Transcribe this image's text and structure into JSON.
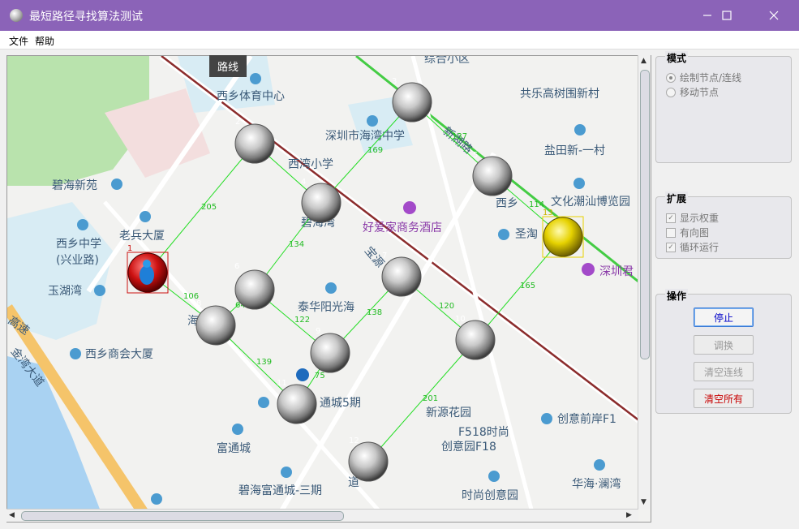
{
  "window": {
    "title": "最短路径寻找算法测试",
    "minimize": "—",
    "maximize": "☐",
    "close": "✕"
  },
  "menu": [
    "文件",
    "帮助"
  ],
  "tooltip": "路线",
  "map_labels": [
    {
      "text": "西乡体育中心"
    },
    {
      "text": "深圳市海湾中学"
    },
    {
      "text": "西湾小学"
    },
    {
      "text": "碧海新苑"
    },
    {
      "text": "老兵大厦"
    },
    {
      "text": "西乡中学"
    },
    {
      "text": "(兴业路)"
    },
    {
      "text": "玉湖湾"
    },
    {
      "text": "西乡商会大厦"
    },
    {
      "text": "泰华阳光海"
    },
    {
      "text": "好爱家商务酒店"
    },
    {
      "text": "碧海湾"
    },
    {
      "text": "共乐高树围新村"
    },
    {
      "text": "盐田新-一村"
    },
    {
      "text": "文化潮汕博览园"
    },
    {
      "text": "圣淘"
    },
    {
      "text": "深圳君"
    },
    {
      "text": "新源花园"
    },
    {
      "text": "F518时尚"
    },
    {
      "text": "创意园F18"
    },
    {
      "text": "创意前岸F1"
    },
    {
      "text": "富通城"
    },
    {
      "text": "碧海富通城-三期"
    },
    {
      "text": "通城5期"
    },
    {
      "text": "时尚创意园"
    },
    {
      "text": "华海·澜湾"
    },
    {
      "text": "金湾大道"
    },
    {
      "text": "综合小区"
    },
    {
      "text": "新湖路"
    },
    {
      "text": "宝源"
    },
    {
      "text": "道"
    },
    {
      "text": "西乡"
    },
    {
      "text": "海"
    },
    {
      "text": "高速"
    }
  ],
  "nodes": [
    {
      "id": "1",
      "type": "start"
    },
    {
      "id": "2",
      "type": "normal"
    },
    {
      "id": "3",
      "type": "normal"
    },
    {
      "id": "4",
      "type": "normal"
    },
    {
      "id": "5",
      "type": "normal"
    },
    {
      "id": "6",
      "type": "normal"
    },
    {
      "id": "7",
      "type": "normal"
    },
    {
      "id": "8",
      "type": "normal"
    },
    {
      "id": "9",
      "type": "normal"
    },
    {
      "id": "10",
      "type": "normal"
    },
    {
      "id": "11",
      "type": "normal"
    },
    {
      "id": "12",
      "type": "normal"
    },
    {
      "id": "13",
      "type": "end"
    }
  ],
  "edge_weights": [
    "205",
    "169",
    "137",
    "134",
    "114",
    "106",
    "64",
    "122",
    "138",
    "120",
    "165",
    "139",
    "75",
    "201"
  ],
  "panel": {
    "mode": {
      "title": "模式",
      "options": [
        "绘制节点/连线",
        "移动节点"
      ],
      "selected": "绘制节点/连线"
    },
    "extend": {
      "title": "扩展",
      "options": [
        {
          "label": "显示权重",
          "checked": true
        },
        {
          "label": "有向图",
          "checked": false
        },
        {
          "label": "循环运行",
          "checked": true
        }
      ]
    },
    "ops": {
      "title": "操作",
      "buttons": [
        "停止",
        "调换",
        "清空连线",
        "清空所有"
      ]
    }
  },
  "colors": {
    "titlebar": "#8b63b8",
    "edge": "#22dd22",
    "start": "#cc1111",
    "end": "#e8d200"
  }
}
